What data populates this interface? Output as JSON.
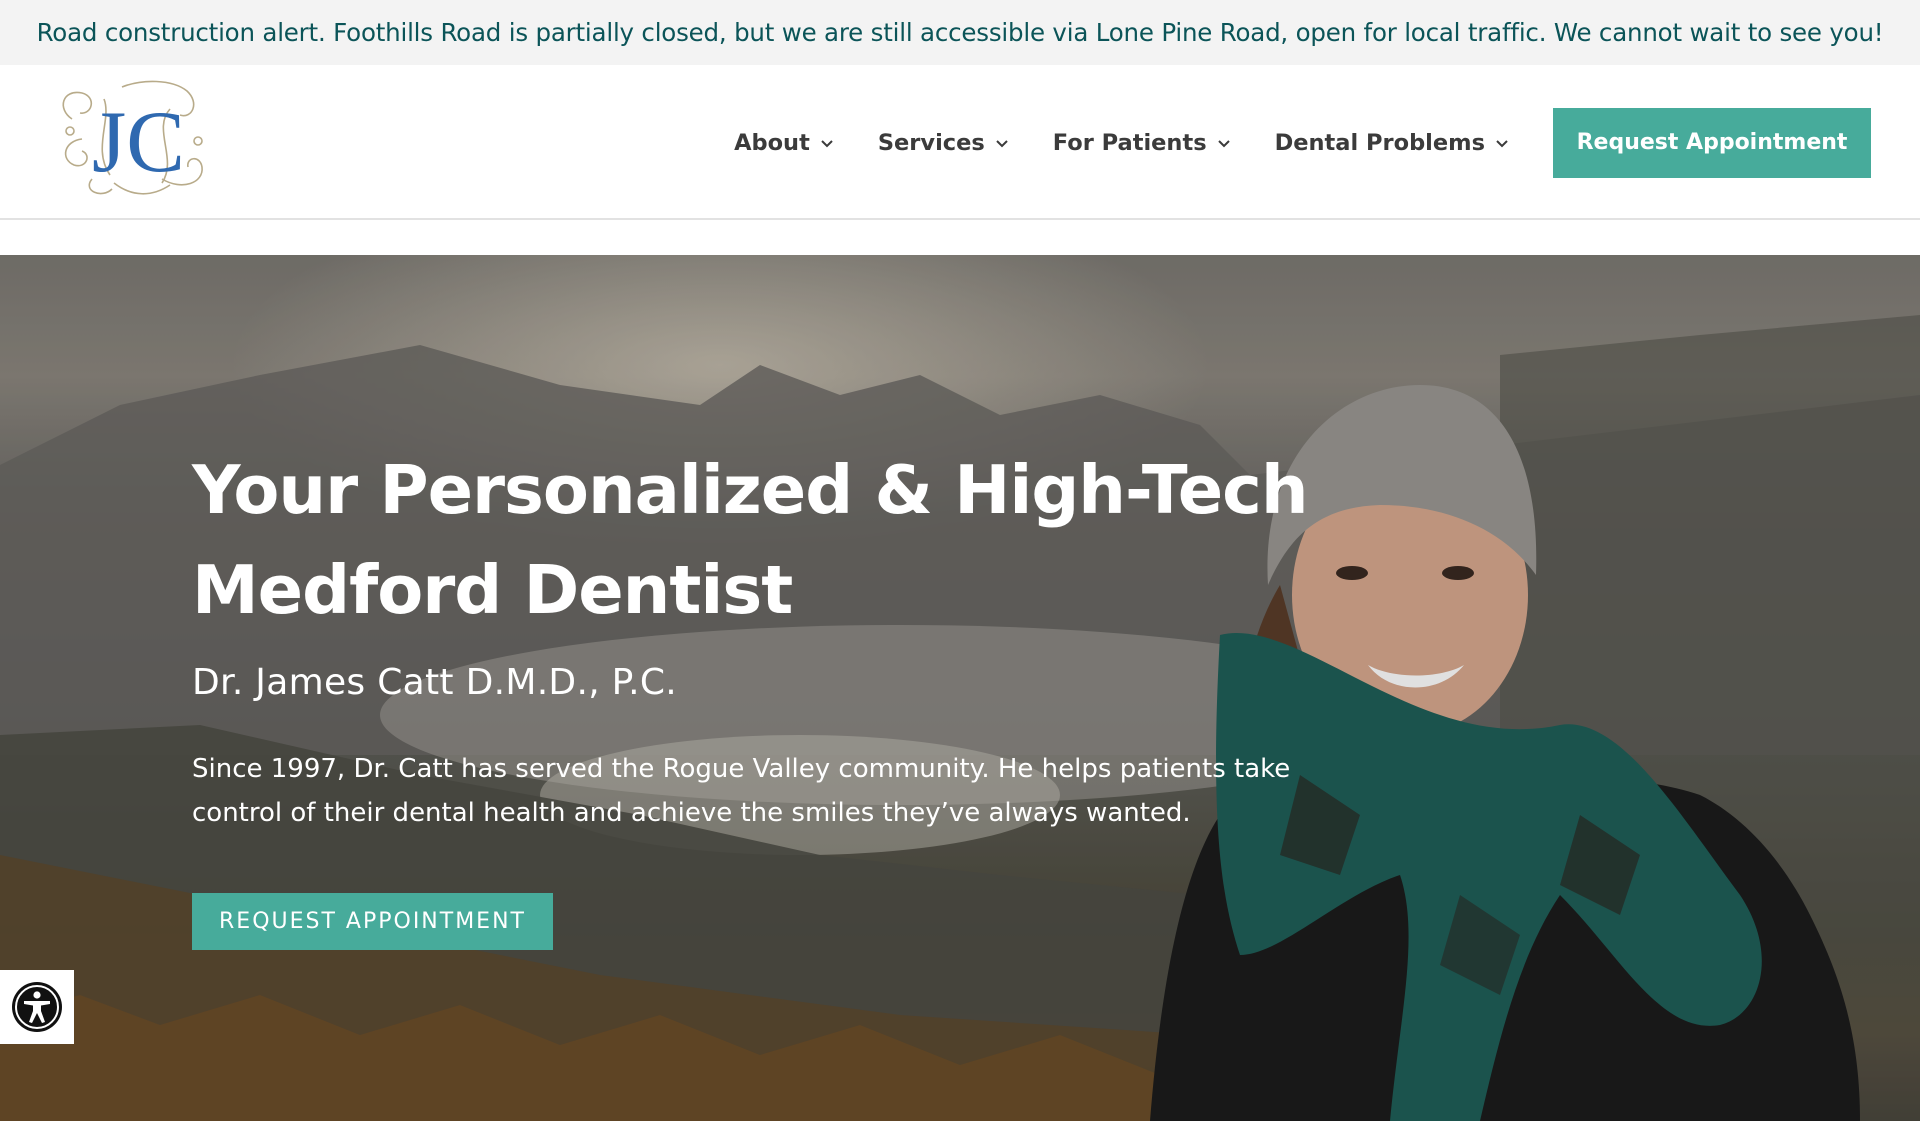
{
  "alert": {
    "text": "Road construction alert. Foothills Road is partially closed, but we are still accessible via Lone Pine Road, open for local traffic. We cannot wait to see you!"
  },
  "header": {
    "logo_text": "JC",
    "nav": [
      {
        "label": "About",
        "icon": "chevron-down-icon"
      },
      {
        "label": "Services",
        "icon": "chevron-down-icon"
      },
      {
        "label": "For Patients",
        "icon": "chevron-down-icon"
      },
      {
        "label": "Dental Problems",
        "icon": "chevron-down-icon"
      }
    ],
    "cta_label": "Request Appointment"
  },
  "hero": {
    "title": "Your Personalized & High-Tech Medford Dentist",
    "subtitle": "Dr. James Catt D.M.D., P.C.",
    "description": "Since 1997, Dr. Catt has served the Rogue Valley community. He helps patients take control of their dental health and achieve the smiles they’ve always wanted.",
    "cta_label": "REQUEST APPOINTMENT"
  },
  "accessibility": {
    "icon": "accessibility-icon"
  },
  "colors": {
    "accent": "#47ab9b",
    "alert_text": "#0b5458",
    "nav_text": "#3b3b3b"
  }
}
